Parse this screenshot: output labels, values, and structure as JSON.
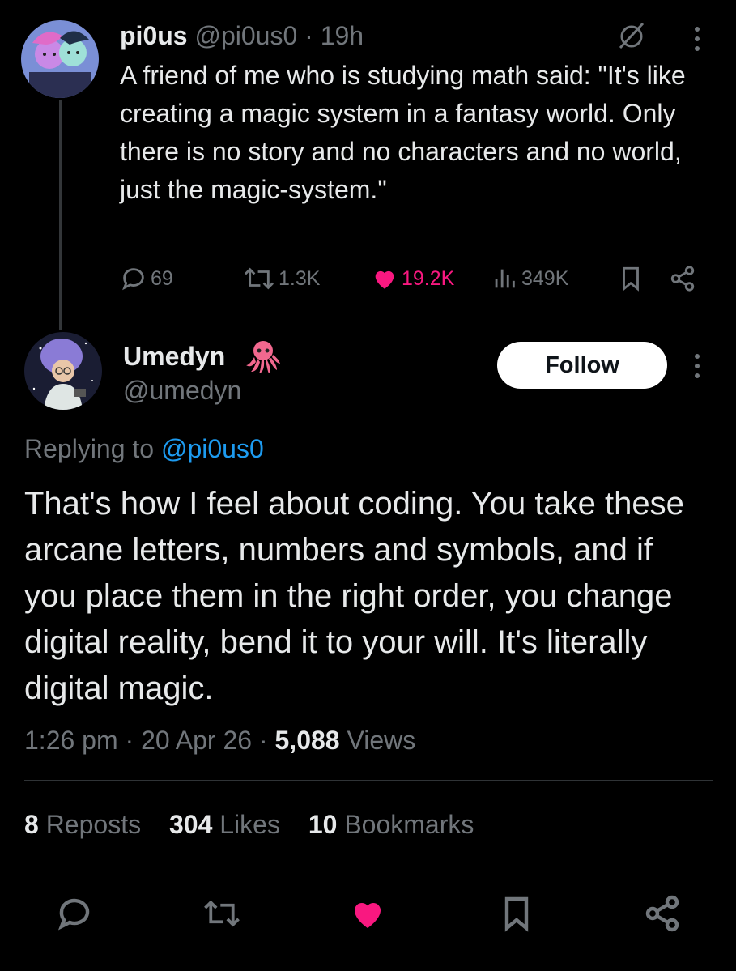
{
  "parent": {
    "name": "pi0us",
    "handle": "@pi0us0",
    "separator": "·",
    "time": "19h",
    "text": "A friend of me who is studying math said: \"It's like creating a magic system in a fantasy world. Only there is no story and no characters and no world, just the magic-system.\"",
    "replies": "69",
    "reposts": "1.3K",
    "likes": "19.2K",
    "views": "349K"
  },
  "tweet": {
    "display_name": "Umedyn",
    "handle": "@umedyn",
    "follow_label": "Follow",
    "replying_prefix": "Replying to",
    "replying_to": "@pi0us0",
    "text": "That's how I feel about coding. You take these arcane letters, numbers and symbols, and if you place them in the right order, you change digital reality, bend it to your will. It's literally digital magic.",
    "time": "1:26 pm",
    "date": "20 Apr 26",
    "separator": "·",
    "views_count": "5,088",
    "views_label": "Views"
  },
  "stats": {
    "reposts_count": "8",
    "reposts_label": "Reposts",
    "likes_count": "304",
    "likes_label": "Likes",
    "bookmarks_count": "10",
    "bookmarks_label": "Bookmarks"
  },
  "colors": {
    "background": "#000000",
    "text": "#e7e9ea",
    "muted": "#71767b",
    "like": "#f91880",
    "link": "#1d9bf0"
  },
  "icons": [
    "reply-icon",
    "repost-icon",
    "heart-icon",
    "views-icon",
    "bookmark-icon",
    "share-icon",
    "grok-icon",
    "more-icon",
    "octopus-emoji"
  ]
}
